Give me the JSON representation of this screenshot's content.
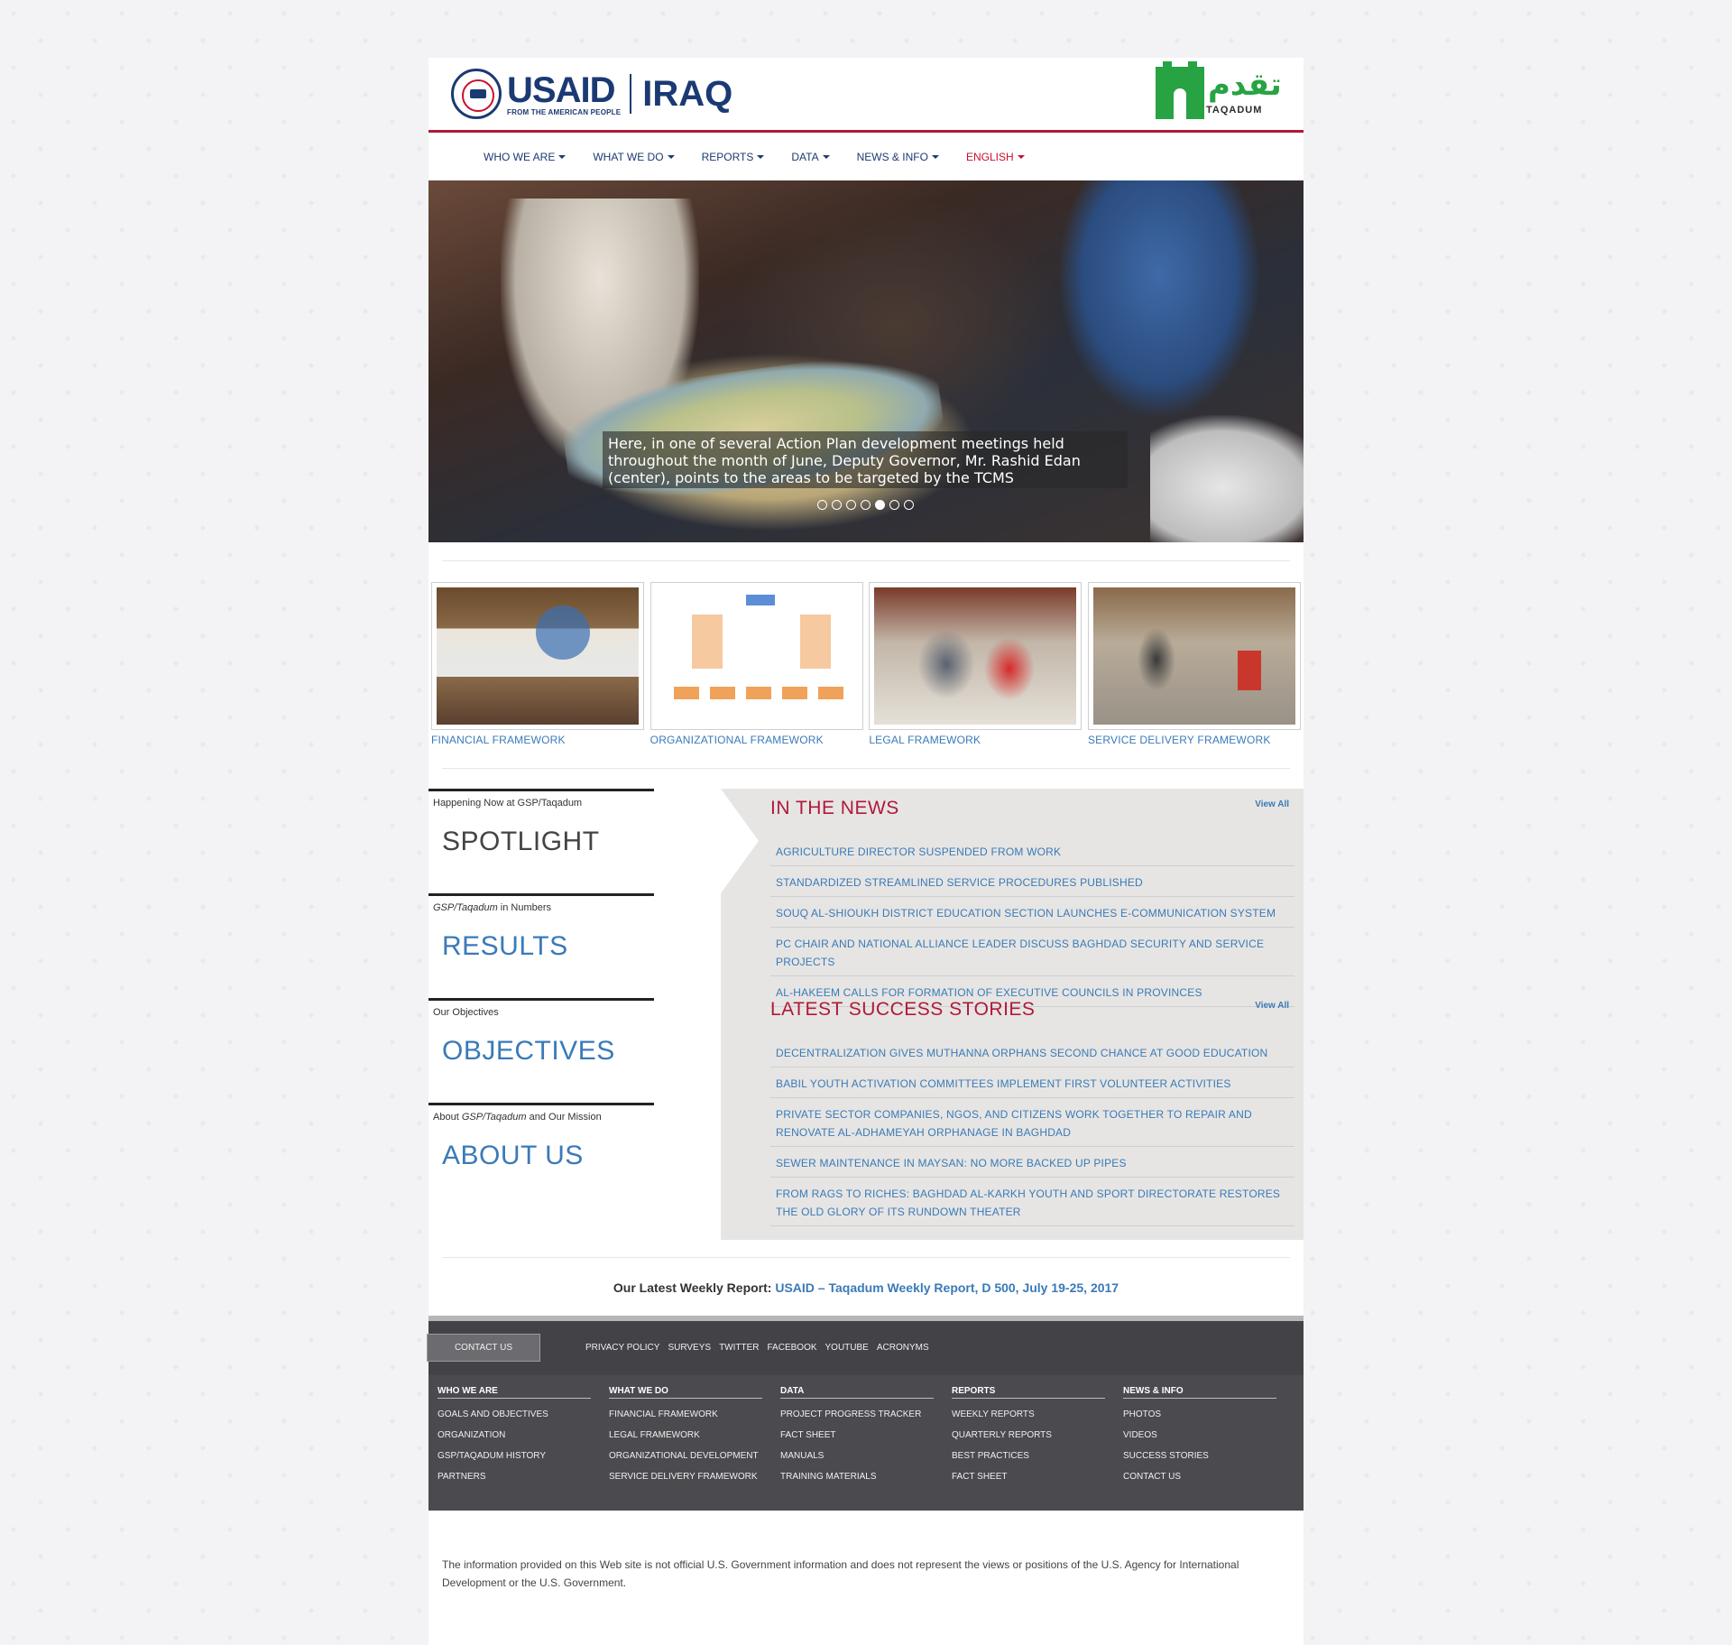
{
  "header": {
    "usaid_wordmark": "USAID",
    "usaid_tagline": "FROM THE AMERICAN PEOPLE",
    "country": "IRAQ",
    "taqadum_arabic": "تقدم",
    "taqadum_latin": "TAQADUM",
    "seal_text": "USAID"
  },
  "nav": {
    "items": [
      {
        "label": "WHO WE ARE"
      },
      {
        "label": "WHAT WE DO"
      },
      {
        "label": "REPORTS"
      },
      {
        "label": "DATA"
      },
      {
        "label": "NEWS & INFO"
      },
      {
        "label": "ENGLISH"
      }
    ]
  },
  "hero": {
    "caption": "Here, in one of several Action Plan development meetings held throughout the month of June, Deputy Governor, Mr. Rashid Edan (center), points to the areas to be targeted by the TCMS",
    "slide_count": 7,
    "active_slide_index": 4
  },
  "frameworks": [
    {
      "label": "FINANCIAL FRAMEWORK"
    },
    {
      "label": "ORGANIZATIONAL FRAMEWORK"
    },
    {
      "label": "LEGAL FRAMEWORK"
    },
    {
      "label": "SERVICE DELIVERY FRAMEWORK"
    }
  ],
  "left_blocks": {
    "spotlight": {
      "sub": "Happening Now at GSP/Taqadum",
      "title": "SPOTLIGHT"
    },
    "results": {
      "sub_italic": "GSP/Taqadum",
      "sub_rest": " in Numbers",
      "title": "RESULTS"
    },
    "objectives": {
      "sub": "Our Objectives",
      "title": "OBJECTIVES"
    },
    "about": {
      "sub_pre": "About ",
      "sub_italic": "GSP/Taqadum",
      "sub_rest": " and Our Mission",
      "title": "ABOUT US"
    }
  },
  "in_the_news": {
    "title": "IN THE NEWS",
    "view_all": "View All",
    "items": [
      "AGRICULTURE DIRECTOR SUSPENDED FROM WORK",
      "STANDARDIZED STREAMLINED SERVICE PROCEDURES PUBLISHED",
      "SOUQ AL-SHIOUKH DISTRICT EDUCATION SECTION LAUNCHES E-COMMUNICATION SYSTEM",
      "PC CHAIR AND NATIONAL ALLIANCE LEADER DISCUSS BAGHDAD SECURITY AND SERVICE PROJECTS",
      "AL-HAKEEM CALLS FOR FORMATION OF EXECUTIVE COUNCILS IN PROVINCES"
    ]
  },
  "success_stories": {
    "title": "LATEST SUCCESS STORIES",
    "view_all": "View All",
    "items": [
      "DECENTRALIZATION GIVES MUTHANNA ORPHANS SECOND CHANCE AT GOOD EDUCATION",
      "BABIL YOUTH ACTIVATION COMMITTEES IMPLEMENT FIRST VOLUNTEER ACTIVITIES",
      "PRIVATE SECTOR COMPANIES, NGOS, AND CITIZENS WORK TOGETHER TO REPAIR AND RENOVATE AL-ADHAMEYAH ORPHANAGE IN BAGHDAD",
      "SEWER MAINTENANCE IN MAYSAN: NO MORE BACKED UP PIPES",
      "FROM RAGS TO RICHES: BAGHDAD AL-KARKH YOUTH AND SPORT DIRECTORATE RESTORES THE OLD GLORY OF ITS RUNDOWN THEATER"
    ]
  },
  "weekly": {
    "prefix": "Our Latest Weekly Report:",
    "link": "USAID – Taqadum Weekly Report, D 500, July 19-25, 2017"
  },
  "footer": {
    "contact_button": "CONTACT US",
    "links": [
      "PRIVACY POLICY",
      "SURVEYS",
      "TWITTER",
      "FACEBOOK",
      "YOUTUBE",
      "ACRONYMS"
    ],
    "columns": [
      {
        "heading": "WHO WE ARE",
        "items": [
          "GOALS AND OBJECTIVES",
          "ORGANIZATION",
          "GSP/TAQADUM HISTORY",
          "PARTNERS"
        ]
      },
      {
        "heading": "WHAT WE DO",
        "items": [
          "FINANCIAL FRAMEWORK",
          "LEGAL FRAMEWORK",
          "ORGANIZATIONAL DEVELOPMENT",
          "SERVICE DELIVERY FRAMEWORK"
        ]
      },
      {
        "heading": "DATA",
        "items": [
          "PROJECT PROGRESS TRACKER",
          "FACT SHEET",
          "MANUALS",
          "TRAINING MATERIALS"
        ]
      },
      {
        "heading": "REPORTS",
        "items": [
          "WEEKLY REPORTS",
          "QUARTERLY REPORTS",
          "BEST PRACTICES",
          "FACT SHEET"
        ]
      },
      {
        "heading": "NEWS & INFO",
        "items": [
          "PHOTOS",
          "VIDEOS",
          "SUCCESS STORIES",
          "CONTACT US"
        ]
      }
    ]
  },
  "disclaimer": "The information provided on this Web site is not official U.S. Government information and does not represent the views or positions of the U.S. Agency for International Development or the U.S. Government.",
  "colors": {
    "brand_navy": "#1b3a73",
    "accent_red": "#b0183a",
    "link_blue": "#3a7ab8",
    "taqadum_green": "#27a343",
    "footer_dark": "#4a4a4f"
  }
}
